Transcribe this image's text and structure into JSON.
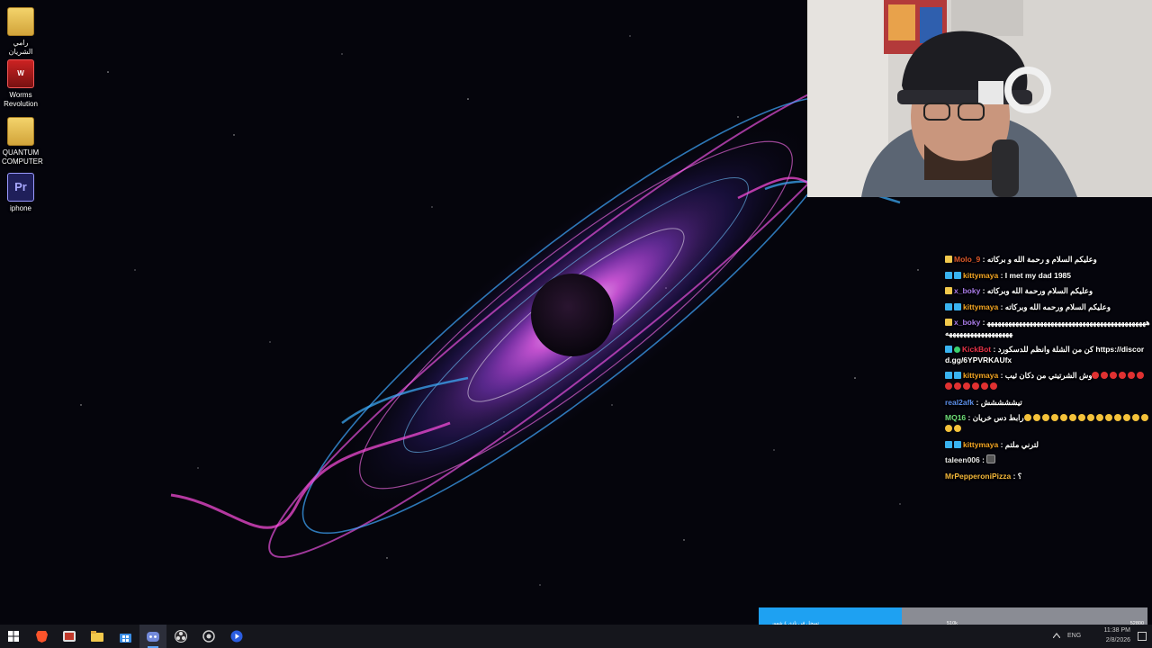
{
  "desktop": {
    "icons": [
      {
        "label": "رامي الشريان",
        "icon": "folder-icon"
      },
      {
        "label": "Worms Revolution",
        "icon": "worms-game-icon"
      },
      {
        "label": "QUANTUM COMPUTER",
        "icon": "folder-icon"
      },
      {
        "label": "iphone",
        "icon": "premiere-project-icon"
      }
    ]
  },
  "chat": {
    "messages": [
      {
        "user": "Molo_9",
        "color": "#e05a2b",
        "badges": [
          "yellow"
        ],
        "text": "وعليكم السلام و رحمة الله و بركاته"
      },
      {
        "user": "kittymaya",
        "color": "#f5a623",
        "badges": [
          "blue",
          "blue"
        ],
        "text": "I met my dad 1985"
      },
      {
        "user": "x_boky",
        "color": "#a87be8",
        "badges": [
          "yellow"
        ],
        "text": "وعليكم السلام ورحمة الله وبركاته"
      },
      {
        "user": "kittymaya",
        "color": "#f5a623",
        "badges": [
          "blue",
          "blue"
        ],
        "text": "وعليكم السلام ورحمه الله وبركاته"
      },
      {
        "user": "x_boky",
        "color": "#a87be8",
        "badges": [
          "yellow"
        ],
        "text": "ههههههههههههههههههههههههههههههههههههههههههههههههههههههههههههههههه"
      },
      {
        "user": "KickBot",
        "color": "#e8334a",
        "badges": [
          "blue",
          "green"
        ],
        "text": "كن من الشلة وانظم للدسكورد https://discord.gg/6YPVRKAUfx"
      },
      {
        "user": "kittymaya",
        "color": "#f5a623",
        "badges": [
          "blue",
          "blue"
        ],
        "text": "وش الشرتيتي من دكان ثيب",
        "emotes": [
          "red",
          "red",
          "red",
          "red",
          "red",
          "red",
          "red",
          "red",
          "red",
          "red",
          "red",
          "red"
        ]
      },
      {
        "user": "real2afk",
        "color": "#5b8de8",
        "badges": [],
        "text": "تيششششش"
      },
      {
        "user": "MQ16",
        "color": "#6fe07a",
        "badges": [],
        "text": "رابط دس خريان",
        "emotes": [
          "cat",
          "cat",
          "cat",
          "cat",
          "cat",
          "cat",
          "cat",
          "cat",
          "cat",
          "cat",
          "cat",
          "cat",
          "cat",
          "cat",
          "cat",
          "cat"
        ]
      },
      {
        "user": "kittymaya",
        "color": "#f5a623",
        "badges": [
          "blue",
          "blue"
        ],
        "text": "لترني ملتم"
      },
      {
        "user": "taleen006",
        "color": "#e8e8e8",
        "badges": [],
        "text": "",
        "emotes": [
          "dark"
        ]
      },
      {
        "user": "MrPepperoniPizza",
        "color": "#f5b83a",
        "badges": [],
        "text": "؟"
      }
    ]
  },
  "alert": {
    "text": "تسجل في نادي ٤ شهور",
    "count": "510k",
    "goal": "52800",
    "progress": 0.368
  },
  "taskbar": {
    "apps": [
      "start-icon",
      "brave-icon",
      "snipping-tool-icon",
      "file-explorer-icon",
      "microsoft-store-icon",
      "discord-icon",
      "obs-icon",
      "chrome-like-icon",
      "media-player-icon"
    ],
    "active": "discord-icon",
    "language": "ENG",
    "time": "11:38 PM",
    "date": "2/8/2026"
  }
}
